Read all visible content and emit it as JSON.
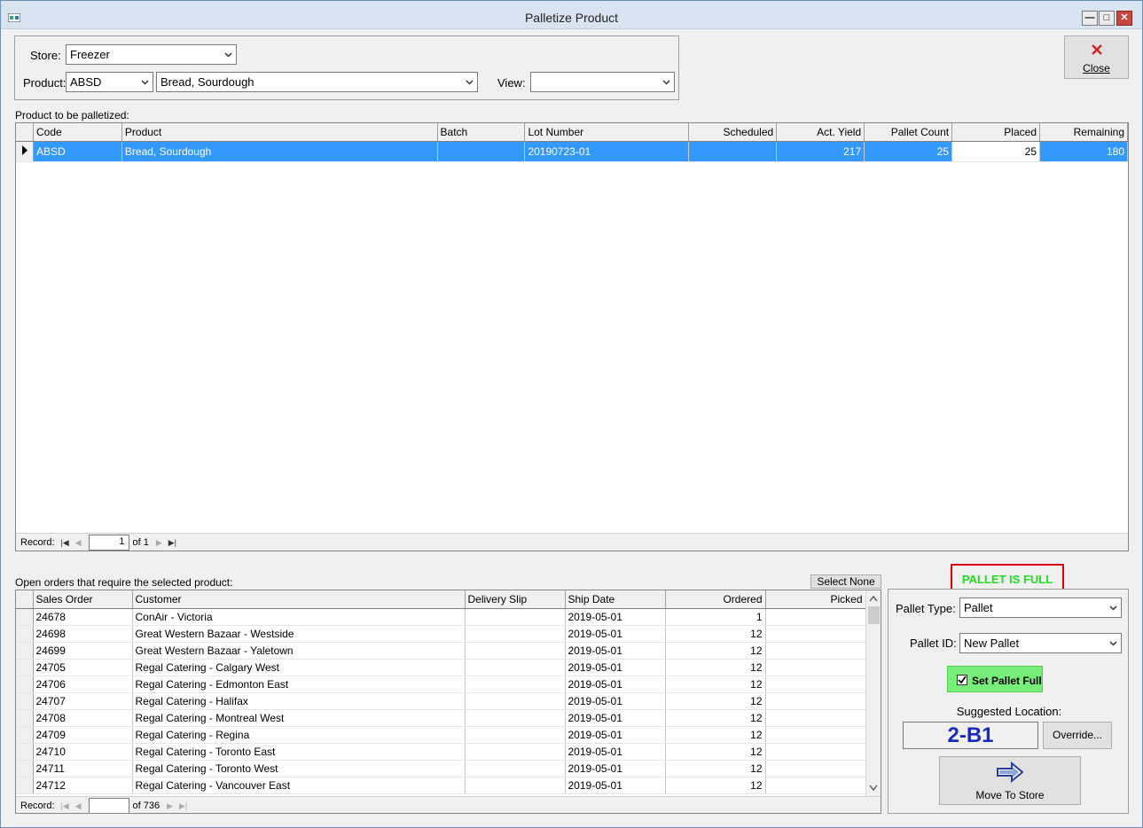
{
  "window": {
    "title": "Palletize Product"
  },
  "filters": {
    "store_label": "Store:",
    "store_value": "Freezer",
    "product_label": "Product:",
    "product_code": "ABSD",
    "product_name": "Bread, Sourdough",
    "view_label": "View:",
    "view_value": ""
  },
  "close_button": {
    "label": "Close"
  },
  "products": {
    "caption": "Product to be palletized:",
    "columns": [
      "Code",
      "Product",
      "Batch",
      "Lot Number",
      "Scheduled",
      "Act. Yield",
      "Pallet Count",
      "Placed",
      "Remaining"
    ],
    "rows": [
      {
        "code": "ABSD",
        "product": "Bread, Sourdough",
        "batch": "",
        "lot": "20190723-01",
        "scheduled": "",
        "yield": "217",
        "pallet_count": "25",
        "placed": "25",
        "remaining": "180"
      }
    ],
    "record_label": "Record:",
    "record_current": "1",
    "record_total": "of 1"
  },
  "orders": {
    "caption": "Open orders that require the selected product:",
    "select_none": "Select None",
    "columns": [
      "Sales Order",
      "Customer",
      "Delivery Slip",
      "Ship Date",
      "Ordered",
      "Picked"
    ],
    "rows": [
      {
        "so": "24678",
        "customer": "ConAir - Victoria",
        "slip": "",
        "date": "2019-05-01",
        "ordered": "1",
        "picked": ""
      },
      {
        "so": "24698",
        "customer": "Great Western Bazaar - Westside",
        "slip": "",
        "date": "2019-05-01",
        "ordered": "12",
        "picked": ""
      },
      {
        "so": "24699",
        "customer": "Great Western Bazaar - Yaletown",
        "slip": "",
        "date": "2019-05-01",
        "ordered": "12",
        "picked": ""
      },
      {
        "so": "24705",
        "customer": "Regal Catering - Calgary West",
        "slip": "",
        "date": "2019-05-01",
        "ordered": "12",
        "picked": ""
      },
      {
        "so": "24706",
        "customer": "Regal Catering - Edmonton East",
        "slip": "",
        "date": "2019-05-01",
        "ordered": "12",
        "picked": ""
      },
      {
        "so": "24707",
        "customer": "Regal Catering - Halifax",
        "slip": "",
        "date": "2019-05-01",
        "ordered": "12",
        "picked": ""
      },
      {
        "so": "24708",
        "customer": "Regal Catering - Montreal West",
        "slip": "",
        "date": "2019-05-01",
        "ordered": "12",
        "picked": ""
      },
      {
        "so": "24709",
        "customer": "Regal Catering - Regina",
        "slip": "",
        "date": "2019-05-01",
        "ordered": "12",
        "picked": ""
      },
      {
        "so": "24710",
        "customer": "Regal Catering - Toronto East",
        "slip": "",
        "date": "2019-05-01",
        "ordered": "12",
        "picked": ""
      },
      {
        "so": "24711",
        "customer": "Regal Catering - Toronto West",
        "slip": "",
        "date": "2019-05-01",
        "ordered": "12",
        "picked": ""
      },
      {
        "so": "24712",
        "customer": "Regal Catering - Vancouver East",
        "slip": "",
        "date": "2019-05-01",
        "ordered": "12",
        "picked": ""
      }
    ],
    "record_label": "Record:",
    "record_current": "",
    "record_total": "of 736"
  },
  "pallet": {
    "status": "PALLET IS FULL",
    "status_color": "#22dd22",
    "type_label": "Pallet Type:",
    "type_value": "Pallet",
    "id_label": "Pallet ID:",
    "id_value": "New Pallet",
    "set_full_label": "Set Pallet Full",
    "set_full_checked": true,
    "suggested_label": "Suggested Location:",
    "suggested_value": "2-B1",
    "override_label": "Override...",
    "move_label": "Move To Store"
  }
}
